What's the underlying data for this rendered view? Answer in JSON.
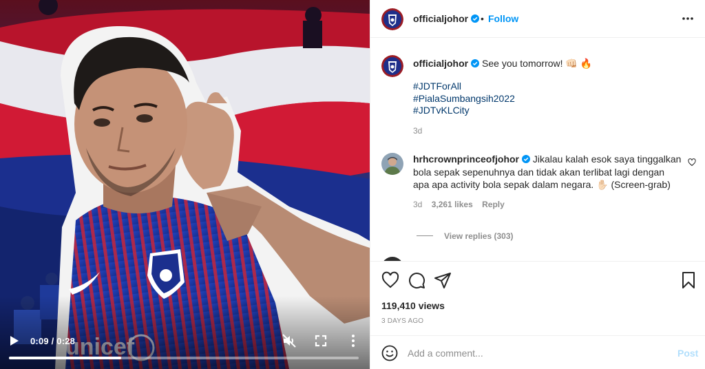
{
  "video": {
    "current_time": "0:09",
    "duration": "0:28",
    "time_separator": "/",
    "progress": 0.32,
    "play_icon": "play-icon",
    "mute_icon": "muted-speaker-icon",
    "fullscreen_icon": "fullscreen-icon",
    "more_icon": "more-vertical-icon"
  },
  "header": {
    "username": "officialjohor",
    "verified_icon": "verified-badge-icon",
    "separator": "•",
    "follow_label": "Follow",
    "more_icon": "more-horizontal-icon"
  },
  "caption": {
    "username": "officialjohor",
    "text": "See you tomorrow! 👊🏻 🔥",
    "hashtags": [
      "#JDTForAll",
      "#PialaSumbangsih2022",
      "#JDTvKLCity"
    ],
    "date": "3d"
  },
  "comment": {
    "username": "hrhcrownprinceofjohor",
    "text": "Jikalau kalah esok saya tinggalkan bola sepak sepenuhnya dan tidak akan terlibat lagi dengan apa apa activity bola sepak dalam negara. ✋🏻 (Screen-grab)",
    "date": "3d",
    "likes": "3,261 likes",
    "reply_label": "Reply",
    "view_replies": "View replies (303)"
  },
  "actions": {
    "like_icon": "heart-icon",
    "comment_icon": "comment-bubble-icon",
    "share_icon": "paper-plane-icon",
    "save_icon": "bookmark-icon",
    "views": "119,410 views",
    "time_ago": "3 DAYS AGO"
  },
  "add_comment": {
    "placeholder": "Add a comment...",
    "post_label": "Post",
    "emoji_icon": "emoji-smiley-icon"
  },
  "colors": {
    "link_blue": "#0095f6",
    "hashtag_blue": "#00376b",
    "post_disabled": "#b2dffc",
    "jersey_blue": "#1d3fb0"
  }
}
